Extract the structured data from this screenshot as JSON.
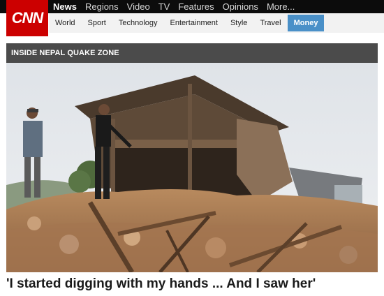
{
  "brand": {
    "logo_text": "CNN",
    "logo_color": "#cc0000"
  },
  "primary_nav": [
    {
      "label": "News",
      "active": true
    },
    {
      "label": "Regions"
    },
    {
      "label": "Video"
    },
    {
      "label": "TV"
    },
    {
      "label": "Features"
    },
    {
      "label": "Opinions"
    },
    {
      "label": "More..."
    }
  ],
  "secondary_nav": [
    {
      "label": "World"
    },
    {
      "label": "Sport"
    },
    {
      "label": "Technology"
    },
    {
      "label": "Entertainment"
    },
    {
      "label": "Style"
    },
    {
      "label": "Travel"
    },
    {
      "label": "Money",
      "active": true
    }
  ],
  "section_banner": "INSIDE NEPAL QUAKE ZONE",
  "headline": "'I started digging with my hands ... And I saw her'",
  "colors": {
    "topbar": "#0c0c0c",
    "banner": "#4b4b4b",
    "active_tab": "#4a90c8"
  }
}
